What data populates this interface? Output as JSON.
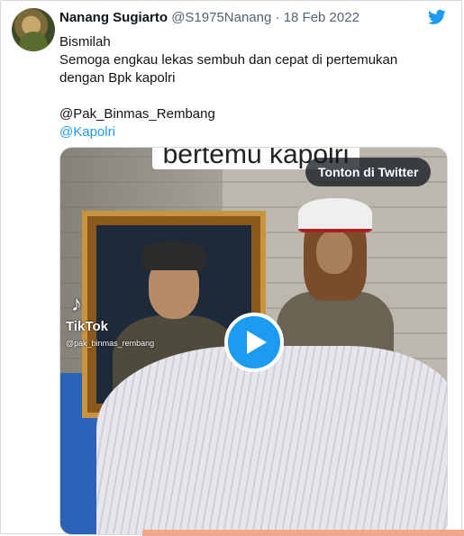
{
  "author": {
    "name": "Nanang Sugiarto",
    "handle": "@S1975Nanang",
    "separator": " · ",
    "date": "18 Feb 2022"
  },
  "tweet": {
    "line1": "Bismilah",
    "line2": "Semoga engkau lekas sembuh dan cepat di pertemukan dengan Bpk kapolri",
    "mention1": "@Pak_Binmas_Rembang",
    "mention2": "@Kapolri"
  },
  "media": {
    "overlay_caption": "bertemu kapolri",
    "watch_button": "Tonton di Twitter",
    "watermark": "TikTok",
    "watermark_user": "@pak_binmas_rembang"
  },
  "icons": {
    "brand": "twitter-bird-icon",
    "play": "play-icon",
    "brand_color": "#1d9bf0"
  }
}
